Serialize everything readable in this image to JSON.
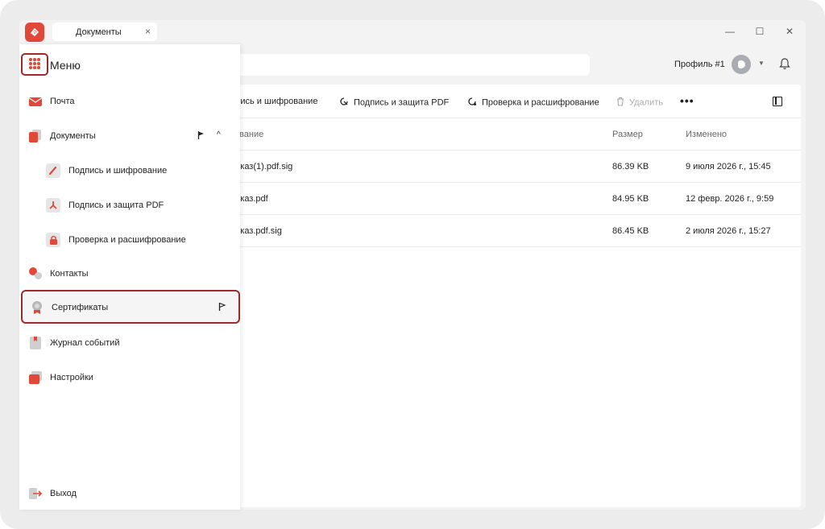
{
  "window": {
    "tab_label": "Документы",
    "tab_close": "×",
    "minimize": "—",
    "maximize": "☐",
    "close": "✕"
  },
  "header": {
    "search_fragment": "к",
    "profile_name": "Профиль #1",
    "profile_caret": "▼"
  },
  "toolbar": {
    "sign_encrypt": "дпись и шифрование",
    "sign_protect_pdf": "Подпись и защита PDF",
    "verify_decrypt": "Проверка и расшифрование",
    "delete": "Удалить",
    "more": "•••"
  },
  "table": {
    "columns": [
      "азвание",
      "Размер",
      "Изменено"
    ],
    "rows": [
      {
        "name": "риказ(1).pdf.sig",
        "size": "86.39 KB",
        "modified": "9 июля 2026 г., 15:45"
      },
      {
        "name": "риказ.pdf",
        "size": "84.95 KB",
        "modified": "12 февр. 2026 г., 9:59"
      },
      {
        "name": "риказ.pdf.sig",
        "size": "86.45 KB",
        "modified": "2 июля 2026 г., 15:27"
      }
    ]
  },
  "menu": {
    "title": "Меню",
    "items": [
      {
        "label": "Почта",
        "icon": "mail-icon"
      },
      {
        "label": "Документы",
        "icon": "documents-icon",
        "expanded": true
      },
      {
        "label": "Подпись и шифрование",
        "icon": "pen-icon"
      },
      {
        "label": "Подпись и защита PDF",
        "icon": "pdf-icon"
      },
      {
        "label": "Проверка и расшифрование",
        "icon": "lock-icon"
      },
      {
        "label": "Контакты",
        "icon": "contacts-icon"
      },
      {
        "label": "Сертификаты",
        "icon": "certificate-icon",
        "selected": true
      },
      {
        "label": "Журнал событий",
        "icon": "journal-icon"
      },
      {
        "label": "Настройки",
        "icon": "settings-icon"
      }
    ],
    "logout": {
      "label": "Выход",
      "icon": "logout-icon"
    },
    "chevron_up": "^"
  },
  "colors": {
    "accent": "#e0483a",
    "highlight_border": "#9b2b2b"
  }
}
